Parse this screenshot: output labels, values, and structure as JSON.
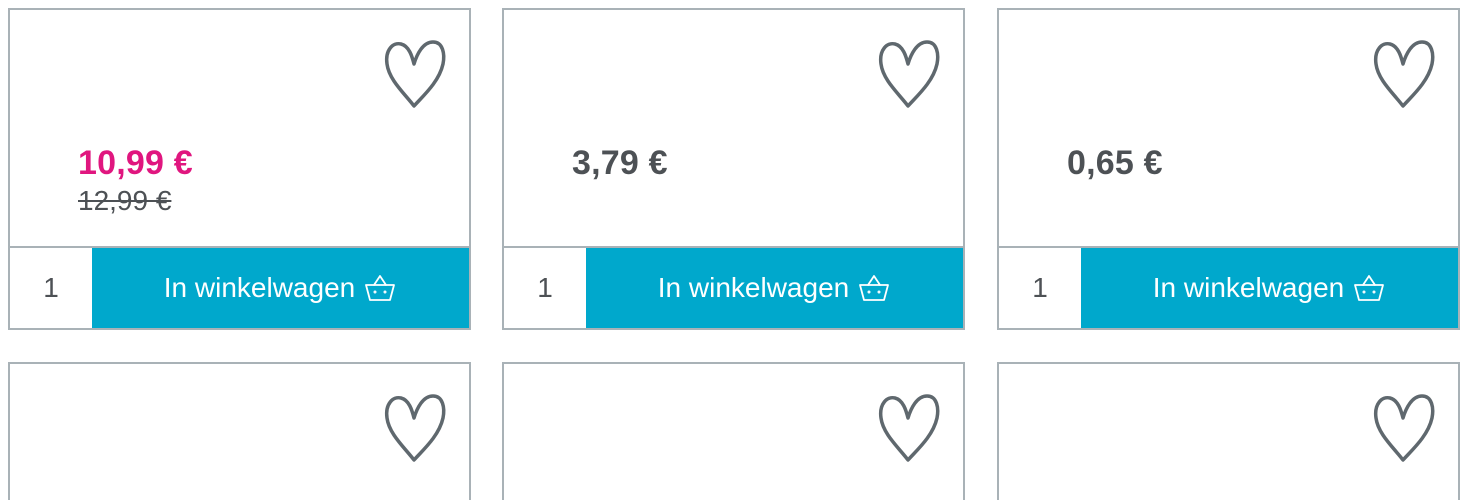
{
  "products": [
    {
      "price": "10,99 €",
      "old_price": "12,99 €",
      "quantity": "1",
      "cart_label": "In winkelwagen"
    },
    {
      "price": "3,79 €",
      "old_price": "",
      "quantity": "1",
      "cart_label": "In winkelwagen"
    },
    {
      "price": "0,65 €",
      "old_price": "",
      "quantity": "1",
      "cart_label": "In winkelwagen"
    }
  ],
  "icons": {
    "favorite": "heart-outline-icon",
    "cart": "basket-icon"
  },
  "colors": {
    "sale_price": "#e0167f",
    "regular_price": "#4d5155",
    "cart_button": "#00a8cc",
    "border": "#a9b2b7",
    "heart": "#5f686e"
  }
}
